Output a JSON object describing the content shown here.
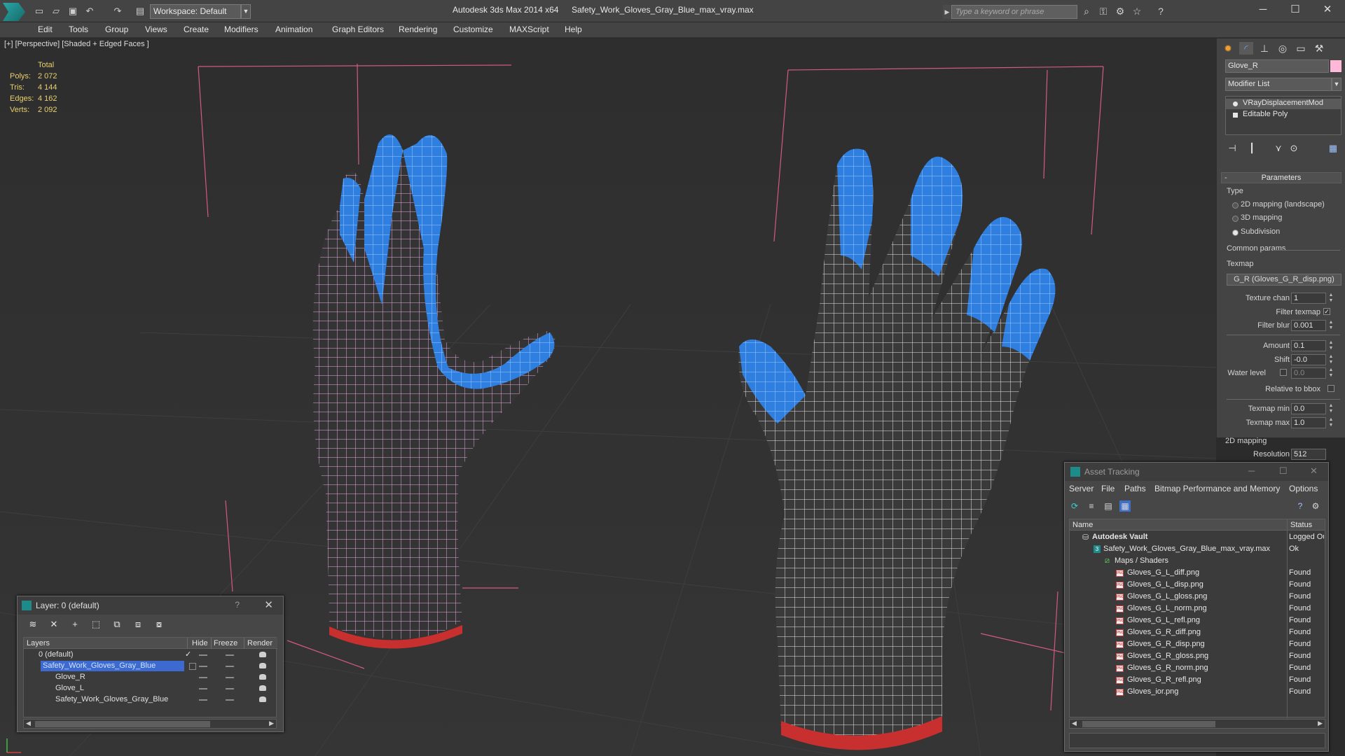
{
  "window": {
    "app_title": "Autodesk 3ds Max  2014 x64",
    "file_title": "Safety_Work_Gloves_Gray_Blue_max_vray.max",
    "workspace": "Workspace: Default",
    "search_placeholder": "Type a keyword or phrase"
  },
  "menu": [
    "Edit",
    "Tools",
    "Group",
    "Views",
    "Create",
    "Modifiers",
    "Animation",
    "Graph Editors",
    "Rendering",
    "Customize",
    "MAXScript",
    "Help"
  ],
  "viewport": {
    "label": "[+] [Perspective] [Shaded + Edged Faces ]",
    "stats": {
      "header": "Total",
      "rows": [
        {
          "label": "Polys:",
          "value": "2 072"
        },
        {
          "label": "Tris:",
          "value": "4 144"
        },
        {
          "label": "Edges:",
          "value": "4 162"
        },
        {
          "label": "Verts:",
          "value": "2 092"
        }
      ]
    },
    "colors": {
      "glove_dark": "#3a3a3a",
      "glove_blue": "#2f7fe0",
      "cuff_red": "#c83030",
      "wire_white": "#f0f0f0",
      "wire_pink": "#e6a8e6",
      "bbox": "#d25a84"
    }
  },
  "layer_window": {
    "title": "Layer: 0 (default)",
    "help": "?",
    "columns": [
      "Layers",
      "Hide",
      "Freeze",
      "Render"
    ],
    "rows": [
      {
        "name": "0 (default)",
        "indent": 0,
        "selected": false
      },
      {
        "name": "Safety_Work_Gloves_Gray_Blue",
        "indent": 1,
        "selected": true
      },
      {
        "name": "Glove_R",
        "indent": 2,
        "selected": false
      },
      {
        "name": "Glove_L",
        "indent": 2,
        "selected": false
      },
      {
        "name": "Safety_Work_Gloves_Gray_Blue",
        "indent": 2,
        "selected": false
      }
    ]
  },
  "command_panel": {
    "object_name": "Glove_R",
    "object_color": "#ffb8d8",
    "modifier_list": "Modifier List",
    "stack": [
      "VRayDisplacementMod",
      "Editable Poly"
    ],
    "parameters": {
      "title": "Parameters",
      "type_label": "Type",
      "types": [
        {
          "label": "2D mapping (landscape)",
          "on": false
        },
        {
          "label": "3D mapping",
          "on": false
        },
        {
          "label": "Subdivision",
          "on": true
        }
      ],
      "common_params": "Common params",
      "texmap_label": "Texmap",
      "texmap": "G_R (Gloves_G_R_disp.png)",
      "texture_chan": {
        "label": "Texture chan",
        "value": "1"
      },
      "filter_texmap": {
        "label": "Filter texmap",
        "checked": true
      },
      "filter_blur": {
        "label": "Filter blur",
        "value": "0.001"
      },
      "amount": {
        "label": "Amount",
        "value": "0.1"
      },
      "shift": {
        "label": "Shift",
        "value": "-0.0"
      },
      "water_level": {
        "label": "Water level",
        "value": "0.0"
      },
      "relative_to_bbox": {
        "label": "Relative to bbox",
        "checked": false
      },
      "texmap_min": {
        "label": "Texmap min",
        "value": "0.0"
      },
      "texmap_max": {
        "label": "Texmap max",
        "value": "1.0"
      },
      "mapping_2d": "2D mapping",
      "resolution": {
        "label": "Resolution",
        "value": "512"
      }
    }
  },
  "asset_tracking": {
    "title": "Asset Tracking",
    "menu": [
      "Server",
      "File",
      "Paths",
      "Bitmap Performance and Memory",
      "Options"
    ],
    "columns": [
      "Name",
      "Status"
    ],
    "rows": [
      {
        "name": "Autodesk Vault",
        "status": "Logged Ou",
        "kind": "vault",
        "indent": 0
      },
      {
        "name": "Safety_Work_Gloves_Gray_Blue_max_vray.max",
        "status": "Ok",
        "kind": "max",
        "indent": 1
      },
      {
        "name": "Maps / Shaders",
        "status": "",
        "kind": "maps",
        "indent": 2
      },
      {
        "name": "Gloves_G_L_diff.png",
        "status": "Found",
        "kind": "png",
        "indent": 3
      },
      {
        "name": "Gloves_G_L_disp.png",
        "status": "Found",
        "kind": "png",
        "indent": 3
      },
      {
        "name": "Gloves_G_L_gloss.png",
        "status": "Found",
        "kind": "png",
        "indent": 3
      },
      {
        "name": "Gloves_G_L_norm.png",
        "status": "Found",
        "kind": "png",
        "indent": 3
      },
      {
        "name": "Gloves_G_L_refl.png",
        "status": "Found",
        "kind": "png",
        "indent": 3
      },
      {
        "name": "Gloves_G_R_diff.png",
        "status": "Found",
        "kind": "png",
        "indent": 3
      },
      {
        "name": "Gloves_G_R_disp.png",
        "status": "Found",
        "kind": "png",
        "indent": 3
      },
      {
        "name": "Gloves_G_R_gloss.png",
        "status": "Found",
        "kind": "png",
        "indent": 3
      },
      {
        "name": "Gloves_G_R_norm.png",
        "status": "Found",
        "kind": "png",
        "indent": 3
      },
      {
        "name": "Gloves_G_R_refl.png",
        "status": "Found",
        "kind": "png",
        "indent": 3
      },
      {
        "name": "Gloves_ior.png",
        "status": "Found",
        "kind": "png",
        "indent": 3
      }
    ]
  }
}
